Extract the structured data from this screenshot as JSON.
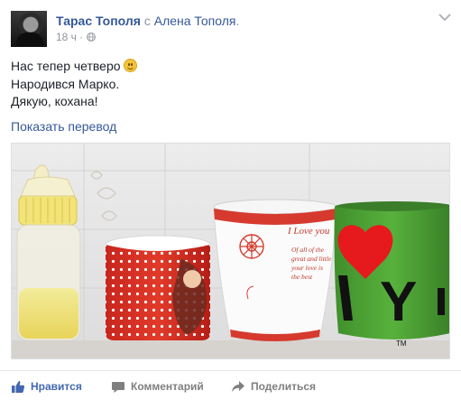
{
  "post": {
    "author": "Тарас Тополя",
    "with_word": "с",
    "tagged": "Алена Тополя",
    "tagged_suffix": ".",
    "time": "18 ч",
    "separator": "·",
    "audience_icon": "globe-icon",
    "menu_icon": "chevron-down-icon",
    "text_lines": [
      "Нас тепер четверо",
      "Народився Марко.",
      "Дякую, кохана!"
    ],
    "emoji": "smiley",
    "translate_link": "Показать перевод",
    "photo": {
      "mug_text_love": "I Love you",
      "mug_text_lines": [
        "Of all of the",
        "great and little",
        "your love is",
        "the best"
      ],
      "ny_letters": "Y",
      "ny_tm": "TM"
    }
  },
  "actions": {
    "like_label": "Нравится",
    "comment_label": "Комментарий",
    "share_label": "Поделиться",
    "like_icon": "thumbs-up-icon",
    "comment_icon": "comment-icon",
    "share_icon": "share-arrow-icon"
  },
  "colors": {
    "link_blue": "#365899",
    "like_blue": "#4267b2",
    "meta_gray": "#90949c",
    "action_gray": "#7f7f7f"
  }
}
